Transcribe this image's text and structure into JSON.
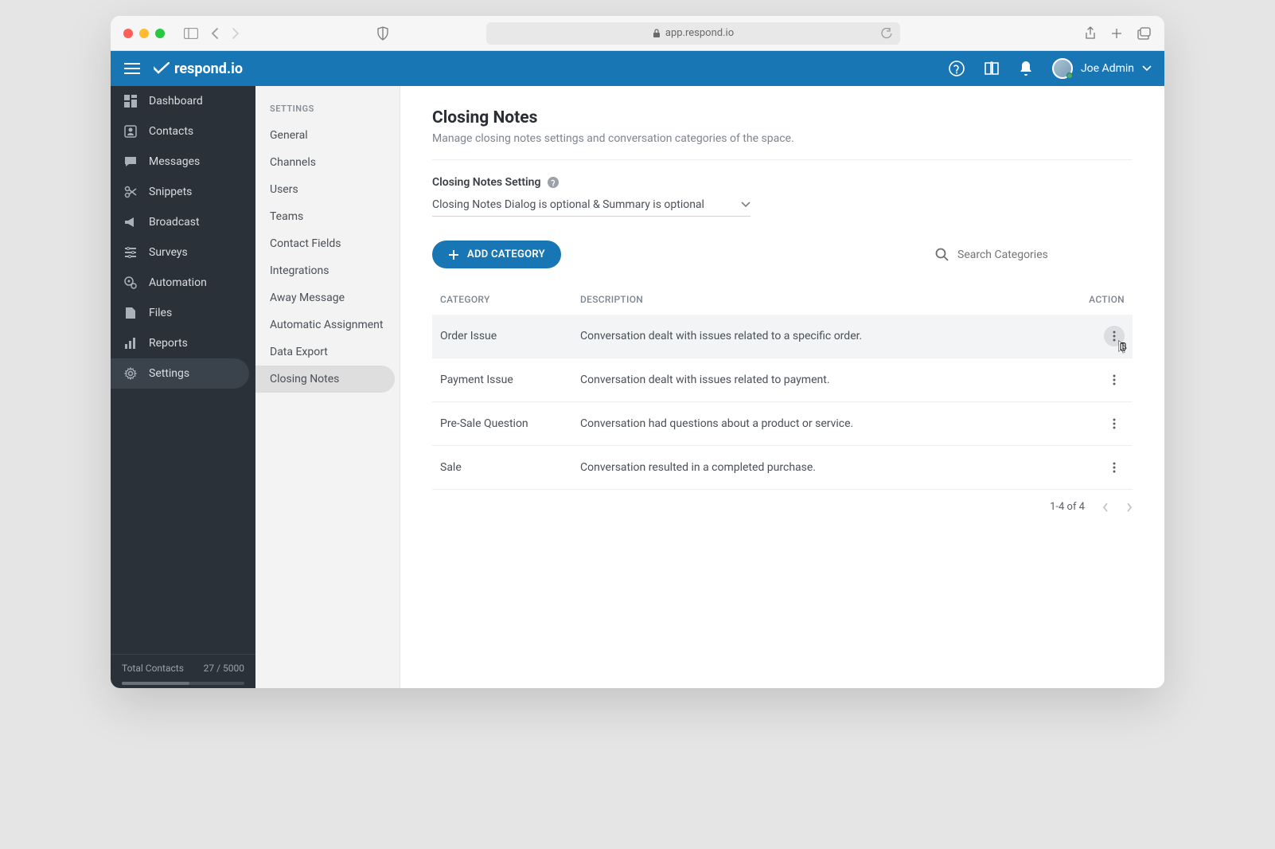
{
  "browser": {
    "url": "app.respond.io"
  },
  "brand": "respond.io",
  "user": {
    "name": "Joe Admin"
  },
  "sidebar": {
    "items": [
      {
        "label": "Dashboard"
      },
      {
        "label": "Contacts"
      },
      {
        "label": "Messages"
      },
      {
        "label": "Snippets"
      },
      {
        "label": "Broadcast"
      },
      {
        "label": "Surveys"
      },
      {
        "label": "Automation"
      },
      {
        "label": "Files"
      },
      {
        "label": "Reports"
      },
      {
        "label": "Settings"
      }
    ],
    "footer_label": "Total Contacts",
    "footer_value": "27 / 5000"
  },
  "settings_nav": {
    "heading": "SETTINGS",
    "items": [
      "General",
      "Channels",
      "Users",
      "Teams",
      "Contact Fields",
      "Integrations",
      "Away Message",
      "Automatic Assignment",
      "Data Export",
      "Closing Notes"
    ]
  },
  "page": {
    "title": "Closing Notes",
    "subtitle": "Manage closing notes settings and conversation categories of the space.",
    "setting_label": "Closing Notes Setting",
    "setting_value": "Closing Notes Dialog is optional & Summary is optional",
    "add_button": "ADD CATEGORY",
    "search_placeholder": "Search Categories",
    "columns": {
      "c1": "CATEGORY",
      "c2": "DESCRIPTION",
      "c3": "ACTION"
    },
    "rows": [
      {
        "cat": "Order Issue",
        "desc": "Conversation dealt with issues related to a specific order."
      },
      {
        "cat": "Payment Issue",
        "desc": "Conversation dealt with issues related to payment."
      },
      {
        "cat": "Pre-Sale Question",
        "desc": "Conversation had questions about a product or service."
      },
      {
        "cat": "Sale",
        "desc": "Conversation resulted in a completed purchase."
      }
    ],
    "pagination": "1-4 of 4"
  }
}
